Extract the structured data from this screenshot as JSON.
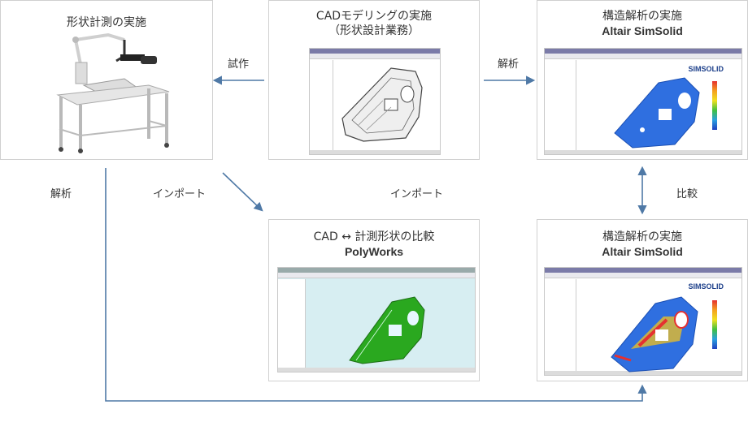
{
  "boxes": {
    "measure": {
      "title": "形状計測の実施"
    },
    "cad": {
      "title_line1": "CADモデリングの実施",
      "title_line2": "（形状設計業務）"
    },
    "analysis_top": {
      "title_line1": "構造解析の実施",
      "title_line2": "Altair SimSolid"
    },
    "compare": {
      "title_line1": "CAD ↔ 計測形状の比較",
      "title_line2": "PolyWorks"
    },
    "analysis_bottom": {
      "title_line1": "構造解析の実施",
      "title_line2": "Altair SimSolid"
    }
  },
  "labels": {
    "prototype": "試作",
    "analysis_right": "解析",
    "analysis_left": "解析",
    "import_left": "インポート",
    "import_right": "インポート",
    "compare": "比較"
  },
  "software_logo": "SIMSOLID",
  "colors": {
    "arrow": "#4f79a6",
    "box_border": "#d0d0d0",
    "sim_blue": "#2f6fe0",
    "poly_green": "#2aa81f",
    "poly_bg": "#d7eef2"
  }
}
